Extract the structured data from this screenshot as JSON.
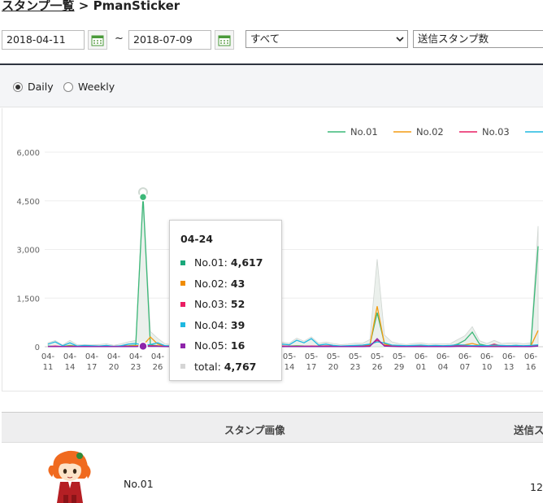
{
  "header": {
    "title_link": "スタンプ一覧",
    "separator": ">",
    "title_name": "PmanSticker"
  },
  "filters": {
    "start_date": "2018-04-11",
    "range_sep": "~",
    "end_date": "2018-07-09",
    "category": "すべて",
    "metric": "送信スタンプ数"
  },
  "period": {
    "daily_label": "Daily",
    "weekly_label": "Weekly",
    "selected": "Daily"
  },
  "chart_data": {
    "type": "line",
    "title": "",
    "xlabel": "",
    "ylabel": "",
    "ylim": [
      0,
      6000
    ],
    "yticks": [
      "0",
      "1,500",
      "3,000",
      "4,500",
      "6,000"
    ],
    "x": [
      "04-11",
      "04-12",
      "04-13",
      "04-14",
      "04-15",
      "04-16",
      "04-17",
      "04-18",
      "04-19",
      "04-20",
      "04-21",
      "04-22",
      "04-23",
      "04-24",
      "04-25",
      "04-26",
      "04-27",
      "04-28",
      "04-29",
      "04-30",
      "05-01",
      "05-02",
      "05-03",
      "05-04",
      "05-05",
      "05-06",
      "05-07",
      "05-08",
      "05-09",
      "05-10",
      "05-11",
      "05-12",
      "05-13",
      "05-14",
      "05-15",
      "05-16",
      "05-17",
      "05-18",
      "05-19",
      "05-20",
      "05-21",
      "05-22",
      "05-23",
      "05-24",
      "05-25",
      "05-26",
      "05-27",
      "05-28",
      "05-29",
      "05-30",
      "05-31",
      "06-01",
      "06-02",
      "06-03",
      "06-04",
      "06-05",
      "06-06",
      "06-07",
      "06-08",
      "06-09",
      "06-10",
      "06-11",
      "06-12",
      "06-13",
      "06-14",
      "06-15",
      "06-16",
      "06-17"
    ],
    "xtick_labels": [
      "04-11",
      "04-14",
      "04-17",
      "04-20",
      "04-23",
      "04-26",
      "04-29",
      "05-02",
      "05-05",
      "05-08",
      "05-11",
      "05-14",
      "05-17",
      "05-20",
      "05-23",
      "05-26",
      "05-29",
      "06-01",
      "06-04",
      "06-07",
      "06-10",
      "06-13",
      "06-16"
    ],
    "legend": [
      "No.01",
      "No.02",
      "No.03",
      "No.04"
    ],
    "legend_position": "top-right",
    "series": [
      {
        "name": "No.01",
        "color": "#3cb878",
        "values": [
          20,
          10,
          8,
          40,
          12,
          8,
          12,
          20,
          15,
          10,
          20,
          30,
          50,
          4617,
          60,
          30,
          20,
          15,
          20,
          30,
          25,
          20,
          10,
          20,
          15,
          20,
          30,
          20,
          25,
          15,
          20,
          30,
          20,
          20,
          30,
          20,
          15,
          20,
          25,
          20,
          15,
          20,
          25,
          20,
          60,
          1050,
          100,
          40,
          20,
          15,
          20,
          30,
          20,
          20,
          25,
          20,
          80,
          200,
          450,
          80,
          30,
          40,
          20,
          30,
          40,
          20,
          40,
          3100
        ]
      },
      {
        "name": "No.02",
        "color": "#f39c12",
        "values": [
          10,
          5,
          5,
          20,
          8,
          5,
          8,
          10,
          10,
          8,
          10,
          20,
          30,
          43,
          300,
          80,
          20,
          10,
          15,
          20,
          15,
          10,
          8,
          15,
          10,
          15,
          20,
          15,
          15,
          10,
          15,
          20,
          15,
          10,
          15,
          10,
          10,
          15,
          10,
          15,
          10,
          15,
          20,
          15,
          40,
          1250,
          80,
          30,
          15,
          10,
          15,
          20,
          15,
          15,
          15,
          15,
          30,
          60,
          100,
          40,
          20,
          20,
          15,
          20,
          20,
          15,
          20,
          500
        ]
      },
      {
        "name": "No.03",
        "color": "#e91e63",
        "values": [
          5,
          20,
          5,
          10,
          15,
          5,
          5,
          15,
          20,
          10,
          25,
          15,
          10,
          52,
          30,
          20,
          15,
          10,
          20,
          15,
          10,
          15,
          10,
          20,
          10,
          15,
          10,
          15,
          20,
          10,
          15,
          10,
          20,
          15,
          10,
          15,
          20,
          15,
          25,
          20,
          15,
          10,
          20,
          15,
          30,
          200,
          40,
          20,
          15,
          10,
          20,
          15,
          10,
          15,
          20,
          15,
          40,
          20,
          30,
          20,
          15,
          80,
          20,
          30,
          15,
          20,
          15,
          40
        ]
      },
      {
        "name": "No.04",
        "color": "#1fb8e0",
        "values": [
          80,
          150,
          30,
          120,
          20,
          40,
          30,
          20,
          40,
          10,
          30,
          80,
          100,
          39,
          70,
          120,
          30,
          20,
          30,
          40,
          30,
          20,
          60,
          120,
          150,
          30,
          40,
          20,
          30,
          80,
          30,
          20,
          80,
          60,
          200,
          120,
          250,
          50,
          80,
          40,
          20,
          30,
          40,
          50,
          80,
          150,
          120,
          50,
          40,
          30,
          40,
          50,
          30,
          40,
          30,
          40,
          60,
          50,
          30,
          40,
          30,
          50,
          40,
          30,
          40,
          30,
          40,
          60
        ]
      },
      {
        "name": "No.05",
        "color": "#8e24aa",
        "values": [
          5,
          5,
          5,
          5,
          5,
          5,
          5,
          5,
          5,
          5,
          5,
          5,
          5,
          16,
          10,
          10,
          5,
          5,
          5,
          5,
          5,
          5,
          5,
          5,
          5,
          5,
          5,
          5,
          5,
          5,
          5,
          5,
          5,
          5,
          5,
          5,
          5,
          5,
          5,
          5,
          5,
          5,
          5,
          5,
          10,
          250,
          20,
          10,
          5,
          5,
          5,
          5,
          5,
          5,
          5,
          5,
          10,
          10,
          10,
          5,
          5,
          5,
          5,
          5,
          5,
          5,
          5,
          20
        ]
      }
    ],
    "total": {
      "name": "total",
      "values": [
        120,
        190,
        53,
        195,
        60,
        63,
        60,
        70,
        90,
        43,
        90,
        150,
        195,
        4767,
        470,
        260,
        90,
        60,
        90,
        110,
        85,
        70,
        93,
        180,
        190,
        85,
        105,
        75,
        95,
        120,
        85,
        85,
        140,
        110,
        265,
        170,
        305,
        105,
        145,
        100,
        65,
        80,
        110,
        105,
        220,
        2700,
        360,
        150,
        95,
        70,
        100,
        120,
        80,
        95,
        95,
        95,
        220,
        340,
        620,
        185,
        100,
        195,
        100,
        115,
        120,
        90,
        120,
        3720
      ]
    }
  },
  "tooltip": {
    "date": "04-24",
    "rows": [
      {
        "label": "No.01:",
        "value": "4,617",
        "color": "#1aa87a"
      },
      {
        "label": "No.02:",
        "value": "43",
        "color": "#f08c00"
      },
      {
        "label": "No.03:",
        "value": "52",
        "color": "#e91e63"
      },
      {
        "label": "No.04:",
        "value": "39",
        "color": "#1fb8e0"
      },
      {
        "label": "No.05:",
        "value": "16",
        "color": "#8e24aa"
      },
      {
        "label": "total:",
        "value": "4,767",
        "color": "#d5d5d5"
      }
    ]
  },
  "table": {
    "headers": [
      "スタンプ画像",
      "送信ス"
    ],
    "rows": [
      {
        "name": "No.01",
        "count": "12"
      }
    ]
  }
}
